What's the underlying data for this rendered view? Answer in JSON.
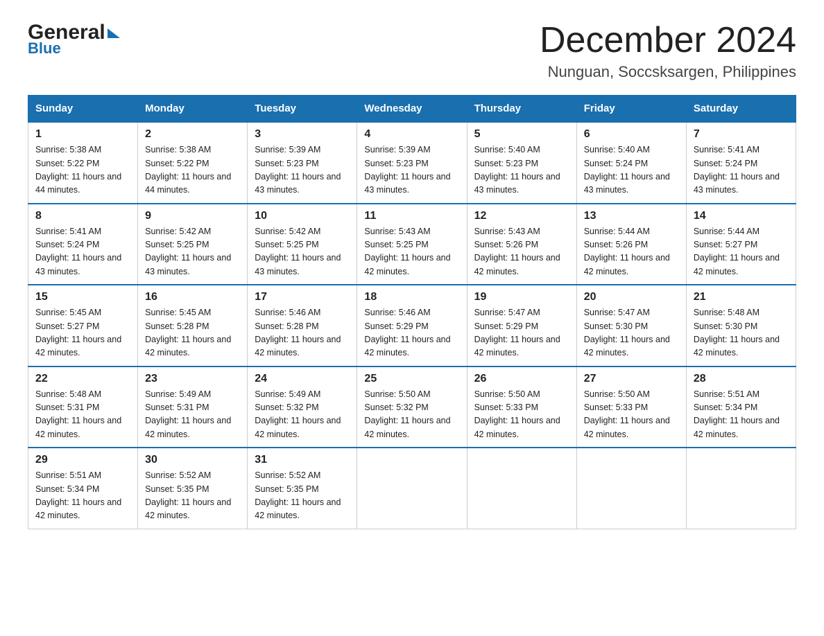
{
  "logo": {
    "general": "General",
    "blue": "Blue",
    "arrow": "▶"
  },
  "title": "December 2024",
  "location": "Nunguan, Soccsksargen, Philippines",
  "weekdays": [
    "Sunday",
    "Monday",
    "Tuesday",
    "Wednesday",
    "Thursday",
    "Friday",
    "Saturday"
  ],
  "weeks": [
    [
      {
        "day": "1",
        "sunrise": "5:38 AM",
        "sunset": "5:22 PM",
        "daylight": "11 hours and 44 minutes."
      },
      {
        "day": "2",
        "sunrise": "5:38 AM",
        "sunset": "5:22 PM",
        "daylight": "11 hours and 44 minutes."
      },
      {
        "day": "3",
        "sunrise": "5:39 AM",
        "sunset": "5:23 PM",
        "daylight": "11 hours and 43 minutes."
      },
      {
        "day": "4",
        "sunrise": "5:39 AM",
        "sunset": "5:23 PM",
        "daylight": "11 hours and 43 minutes."
      },
      {
        "day": "5",
        "sunrise": "5:40 AM",
        "sunset": "5:23 PM",
        "daylight": "11 hours and 43 minutes."
      },
      {
        "day": "6",
        "sunrise": "5:40 AM",
        "sunset": "5:24 PM",
        "daylight": "11 hours and 43 minutes."
      },
      {
        "day": "7",
        "sunrise": "5:41 AM",
        "sunset": "5:24 PM",
        "daylight": "11 hours and 43 minutes."
      }
    ],
    [
      {
        "day": "8",
        "sunrise": "5:41 AM",
        "sunset": "5:24 PM",
        "daylight": "11 hours and 43 minutes."
      },
      {
        "day": "9",
        "sunrise": "5:42 AM",
        "sunset": "5:25 PM",
        "daylight": "11 hours and 43 minutes."
      },
      {
        "day": "10",
        "sunrise": "5:42 AM",
        "sunset": "5:25 PM",
        "daylight": "11 hours and 43 minutes."
      },
      {
        "day": "11",
        "sunrise": "5:43 AM",
        "sunset": "5:25 PM",
        "daylight": "11 hours and 42 minutes."
      },
      {
        "day": "12",
        "sunrise": "5:43 AM",
        "sunset": "5:26 PM",
        "daylight": "11 hours and 42 minutes."
      },
      {
        "day": "13",
        "sunrise": "5:44 AM",
        "sunset": "5:26 PM",
        "daylight": "11 hours and 42 minutes."
      },
      {
        "day": "14",
        "sunrise": "5:44 AM",
        "sunset": "5:27 PM",
        "daylight": "11 hours and 42 minutes."
      }
    ],
    [
      {
        "day": "15",
        "sunrise": "5:45 AM",
        "sunset": "5:27 PM",
        "daylight": "11 hours and 42 minutes."
      },
      {
        "day": "16",
        "sunrise": "5:45 AM",
        "sunset": "5:28 PM",
        "daylight": "11 hours and 42 minutes."
      },
      {
        "day": "17",
        "sunrise": "5:46 AM",
        "sunset": "5:28 PM",
        "daylight": "11 hours and 42 minutes."
      },
      {
        "day": "18",
        "sunrise": "5:46 AM",
        "sunset": "5:29 PM",
        "daylight": "11 hours and 42 minutes."
      },
      {
        "day": "19",
        "sunrise": "5:47 AM",
        "sunset": "5:29 PM",
        "daylight": "11 hours and 42 minutes."
      },
      {
        "day": "20",
        "sunrise": "5:47 AM",
        "sunset": "5:30 PM",
        "daylight": "11 hours and 42 minutes."
      },
      {
        "day": "21",
        "sunrise": "5:48 AM",
        "sunset": "5:30 PM",
        "daylight": "11 hours and 42 minutes."
      }
    ],
    [
      {
        "day": "22",
        "sunrise": "5:48 AM",
        "sunset": "5:31 PM",
        "daylight": "11 hours and 42 minutes."
      },
      {
        "day": "23",
        "sunrise": "5:49 AM",
        "sunset": "5:31 PM",
        "daylight": "11 hours and 42 minutes."
      },
      {
        "day": "24",
        "sunrise": "5:49 AM",
        "sunset": "5:32 PM",
        "daylight": "11 hours and 42 minutes."
      },
      {
        "day": "25",
        "sunrise": "5:50 AM",
        "sunset": "5:32 PM",
        "daylight": "11 hours and 42 minutes."
      },
      {
        "day": "26",
        "sunrise": "5:50 AM",
        "sunset": "5:33 PM",
        "daylight": "11 hours and 42 minutes."
      },
      {
        "day": "27",
        "sunrise": "5:50 AM",
        "sunset": "5:33 PM",
        "daylight": "11 hours and 42 minutes."
      },
      {
        "day": "28",
        "sunrise": "5:51 AM",
        "sunset": "5:34 PM",
        "daylight": "11 hours and 42 minutes."
      }
    ],
    [
      {
        "day": "29",
        "sunrise": "5:51 AM",
        "sunset": "5:34 PM",
        "daylight": "11 hours and 42 minutes."
      },
      {
        "day": "30",
        "sunrise": "5:52 AM",
        "sunset": "5:35 PM",
        "daylight": "11 hours and 42 minutes."
      },
      {
        "day": "31",
        "sunrise": "5:52 AM",
        "sunset": "5:35 PM",
        "daylight": "11 hours and 42 minutes."
      },
      null,
      null,
      null,
      null
    ]
  ]
}
